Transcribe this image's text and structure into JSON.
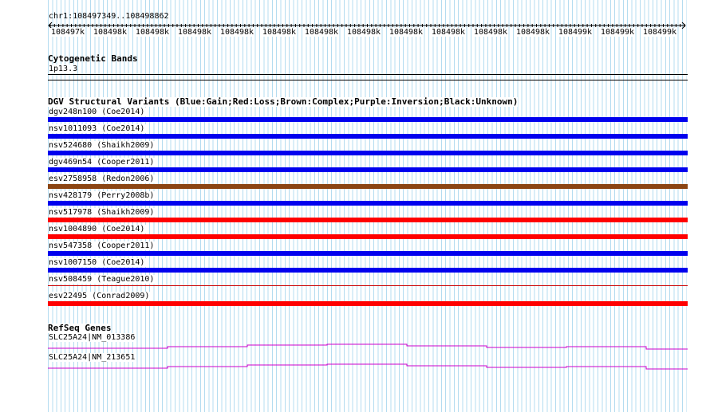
{
  "region": "chr1:108497349..108498862",
  "ruler": {
    "ticks": [
      "108497k",
      "108498k",
      "108498k",
      "108498k",
      "108498k",
      "108498k",
      "108498k",
      "108498k",
      "108498k",
      "108498k",
      "108498k",
      "108498k",
      "108499k",
      "108499k",
      "108499k"
    ]
  },
  "cytobands": {
    "title": "Cytogenetic Bands",
    "band": "1p13.3"
  },
  "dgv": {
    "title": "DGV Structural Variants (Blue:Gain;Red:Loss;Brown:Complex;Purple:Inversion;Black:Unknown)",
    "colors": {
      "gain": "#0000ee",
      "loss": "#ff0000",
      "complex": "#8b4513",
      "thin_loss": "#cc0000"
    },
    "variants": [
      {
        "label": "dgv248n100 (Coe2014)",
        "type": "gain"
      },
      {
        "label": "nsv1011093 (Coe2014)",
        "type": "gain"
      },
      {
        "label": "nsv524680 (Shaikh2009)",
        "type": "gain"
      },
      {
        "label": "dgv469n54 (Cooper2011)",
        "type": "gain"
      },
      {
        "label": "esv2758958 (Redon2006)",
        "type": "complex"
      },
      {
        "label": "nsv428179 (Perry2008b)",
        "type": "gain"
      },
      {
        "label": "nsv517978 (Shaikh2009)",
        "type": "loss"
      },
      {
        "label": "nsv1004890 (Coe2014)",
        "type": "loss"
      },
      {
        "label": "nsv547358 (Cooper2011)",
        "type": "gain"
      },
      {
        "label": "nsv1007150 (Coe2014)",
        "type": "gain"
      },
      {
        "label": "nsv508459 (Teague2010)",
        "type": "thin_loss"
      },
      {
        "label": "esv22495 (Conrad2009)",
        "type": "loss"
      }
    ]
  },
  "refseq": {
    "title": "RefSeq Genes",
    "color": "#cc00cc",
    "genes": [
      {
        "label": "SLC25A24|NM_013386"
      },
      {
        "label": "SLC25A24|NM_213651"
      }
    ]
  }
}
